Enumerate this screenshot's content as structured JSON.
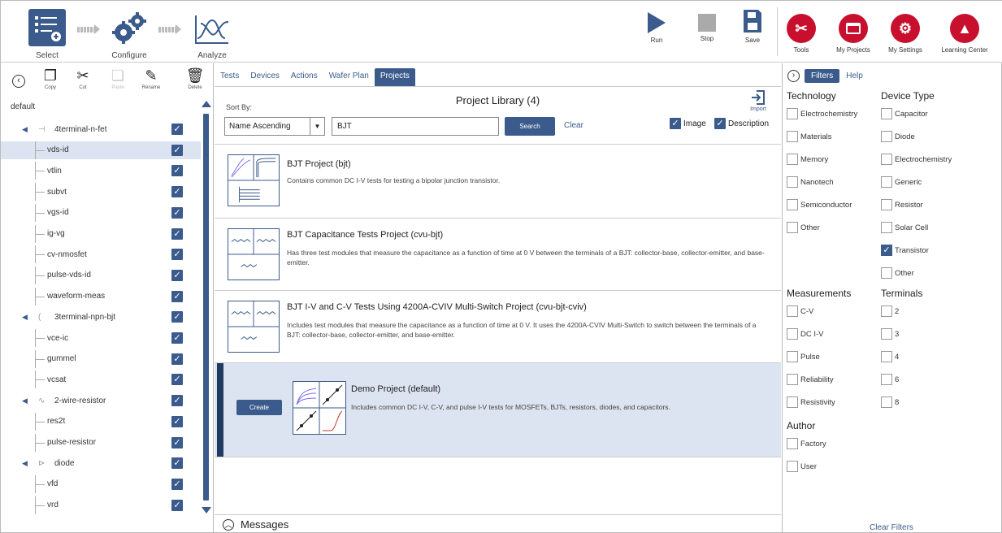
{
  "toolbar": {
    "workflow": [
      "Select",
      "Configure",
      "Analyze"
    ],
    "actions": [
      {
        "label": "Run",
        "icon": "play-icon"
      },
      {
        "label": "Stop",
        "icon": "stop-icon"
      },
      {
        "label": "Save",
        "icon": "save-icon"
      }
    ],
    "right": [
      {
        "label": "Tools",
        "icon": "tools-icon"
      },
      {
        "label": "My Projects",
        "icon": "projects-icon"
      },
      {
        "label": "My Settings",
        "icon": "settings-icon"
      },
      {
        "label": "Learning Center",
        "icon": "graduation-cap-icon"
      }
    ]
  },
  "left_tools": [
    "Copy",
    "Cut",
    "Paste",
    "Rename",
    "Delete"
  ],
  "tree": {
    "root": "default",
    "rows": [
      {
        "label": "4terminal-n-fet",
        "type": "device",
        "icon": "fet-icon"
      },
      {
        "label": "vds-id",
        "type": "test",
        "selected": true
      },
      {
        "label": "vtlin",
        "type": "test"
      },
      {
        "label": "subvt",
        "type": "test"
      },
      {
        "label": "vgs-id",
        "type": "test"
      },
      {
        "label": "ig-vg",
        "type": "test"
      },
      {
        "label": "cv-nmosfet",
        "type": "test"
      },
      {
        "label": "pulse-vds-id",
        "type": "test"
      },
      {
        "label": "waveform-meas",
        "type": "test"
      },
      {
        "label": "3terminal-npn-bjt",
        "type": "device",
        "icon": "bjt-icon"
      },
      {
        "label": "vce-ic",
        "type": "test"
      },
      {
        "label": "gummel",
        "type": "test"
      },
      {
        "label": "vcsat",
        "type": "test"
      },
      {
        "label": "2-wire-resistor",
        "type": "device",
        "icon": "resistor-icon"
      },
      {
        "label": "res2t",
        "type": "test"
      },
      {
        "label": "pulse-resistor",
        "type": "test"
      },
      {
        "label": "diode",
        "type": "device",
        "icon": "diode-icon"
      },
      {
        "label": "vfd",
        "type": "test"
      },
      {
        "label": "vrd",
        "type": "test"
      }
    ]
  },
  "center": {
    "tabs": [
      "Tests",
      "Devices",
      "Actions",
      "Wafer Plan",
      "Projects"
    ],
    "active_tab": "Projects",
    "library_title": "Project Library (4)",
    "sort_label": "Sort By:",
    "sort_value": "Name Ascending",
    "search_value": "BJT",
    "search_button": "Search",
    "clear": "Clear",
    "import": "Import",
    "opt_image": "Image",
    "opt_description": "Description",
    "projects": [
      {
        "name": "BJT Project (bjt)",
        "desc": "Contains common DC I-V tests for testing a bipolar junction transistor."
      },
      {
        "name": "BJT Capacitance Tests Project (cvu-bjt)",
        "desc": "Has three test modules that measure the capacitance as a function of time at 0 V between the terminals of a BJT: collector-base, collector-emitter, and base-emitter."
      },
      {
        "name": "BJT I-V and C-V Tests Using 4200A-CVIV Multi-Switch Project (cvu-bjt-cviv)",
        "desc": "Includes test modules that measure the capacitance as a function of time at 0 V. It uses the 4200A-CVIV Multi-Switch to switch between the terminals of a BJT: collector-base, collector-emitter, and base-emitter."
      },
      {
        "name": "Demo Project (default)",
        "desc": "Includes common DC I-V, C-V, and pulse I-V tests for MOSFETs, BJTs, resistors, diodes, and capacitors.",
        "selected": true
      }
    ],
    "create_button": "Create",
    "messages": "Messages"
  },
  "filters": {
    "tabs": [
      "Filters",
      "Help"
    ],
    "technology": {
      "title": "Technology",
      "items": [
        {
          "label": "Electrochemistry"
        },
        {
          "label": "Materials"
        },
        {
          "label": "Memory"
        },
        {
          "label": "Nanotech"
        },
        {
          "label": "Semiconductor"
        },
        {
          "label": "Other"
        }
      ]
    },
    "device_type": {
      "title": "Device Type",
      "items": [
        {
          "label": "Capacitor"
        },
        {
          "label": "Diode"
        },
        {
          "label": "Electrochemistry"
        },
        {
          "label": "Generic"
        },
        {
          "label": "Resistor"
        },
        {
          "label": "Solar Cell"
        },
        {
          "label": "Transistor",
          "checked": true
        },
        {
          "label": "Other"
        }
      ]
    },
    "measurements": {
      "title": "Measurements",
      "items": [
        {
          "label": "C-V"
        },
        {
          "label": "DC I-V"
        },
        {
          "label": "Pulse"
        },
        {
          "label": "Reliability"
        },
        {
          "label": "Resistivity"
        }
      ]
    },
    "terminals": {
      "title": "Terminals",
      "items": [
        {
          "label": "2"
        },
        {
          "label": "3"
        },
        {
          "label": "4"
        },
        {
          "label": "6"
        },
        {
          "label": "8"
        }
      ]
    },
    "author": {
      "title": "Author",
      "items": [
        {
          "label": "Factory"
        },
        {
          "label": "User"
        }
      ]
    },
    "clear_filters": "Clear Filters"
  }
}
